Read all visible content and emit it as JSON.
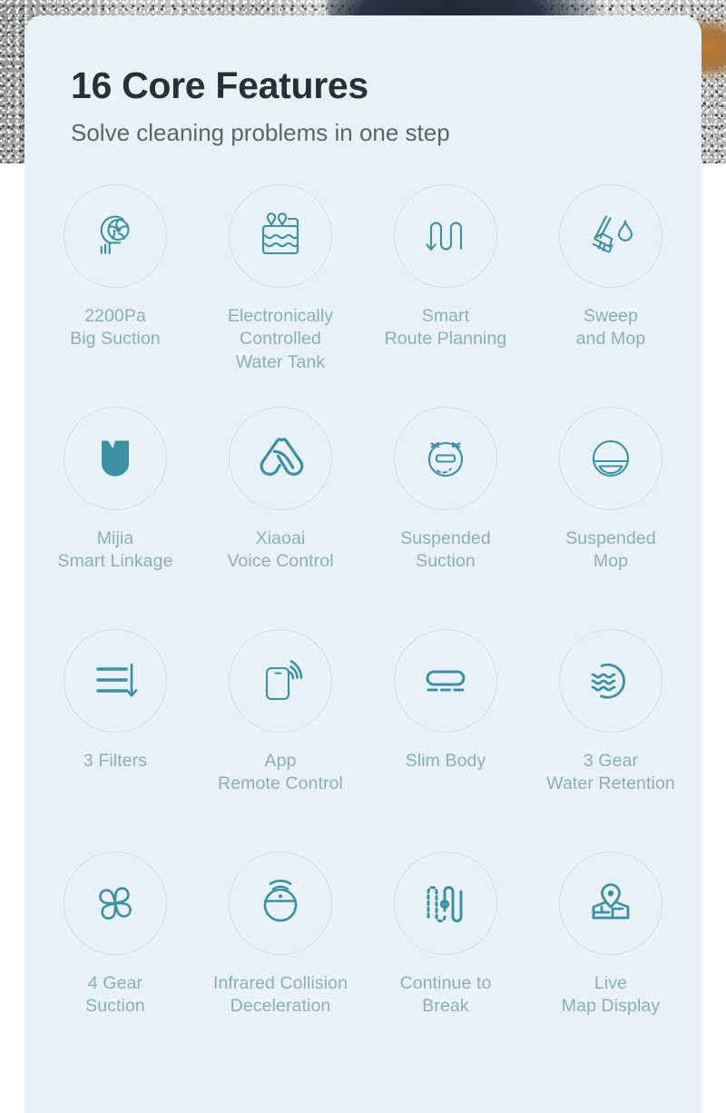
{
  "header": {
    "title": "16 Core Features",
    "subtitle": "Solve cleaning problems in one step"
  },
  "colors": {
    "card_background": "#e9f1f8",
    "title_text": "#2b2f33",
    "subtitle_text": "#5f6468",
    "icon_stroke": "#3d8fa3",
    "icon_ring_border": "#cfdde6",
    "label_text": "#8dadb9"
  },
  "features": [
    {
      "icon": "suction-fan-icon",
      "label": "2200Pa\nBig Suction"
    },
    {
      "icon": "water-tank-icon",
      "label": "Electronically\nControlled\nWater Tank"
    },
    {
      "icon": "route-planning-icon",
      "label": "Smart\nRoute Planning"
    },
    {
      "icon": "broom-water-drop-icon",
      "label": "Sweep\nand Mop"
    },
    {
      "icon": "mijia-logo-icon",
      "label": "Mijia\nSmart Linkage"
    },
    {
      "icon": "xiaoai-voice-icon",
      "label": "Xiaoai\nVoice Control"
    },
    {
      "icon": "suspended-suction-icon",
      "label": "Suspended\nSuction"
    },
    {
      "icon": "suspended-mop-icon",
      "label": "Suspended\nMop"
    },
    {
      "icon": "filters-layers-icon",
      "label": "3 Filters"
    },
    {
      "icon": "phone-remote-icon",
      "label": "App\nRemote Control"
    },
    {
      "icon": "slim-body-icon",
      "label": "Slim Body"
    },
    {
      "icon": "water-retention-icon",
      "label": "3 Gear\nWater Retention"
    },
    {
      "icon": "fan-blades-icon",
      "label": "4 Gear\nSuction"
    },
    {
      "icon": "infrared-collision-icon",
      "label": "Infrared Collision\nDeceleration"
    },
    {
      "icon": "continue-to-break-icon",
      "label": "Continue to\nBreak"
    },
    {
      "icon": "live-map-pin-icon",
      "label": "Live\nMap Display"
    }
  ]
}
